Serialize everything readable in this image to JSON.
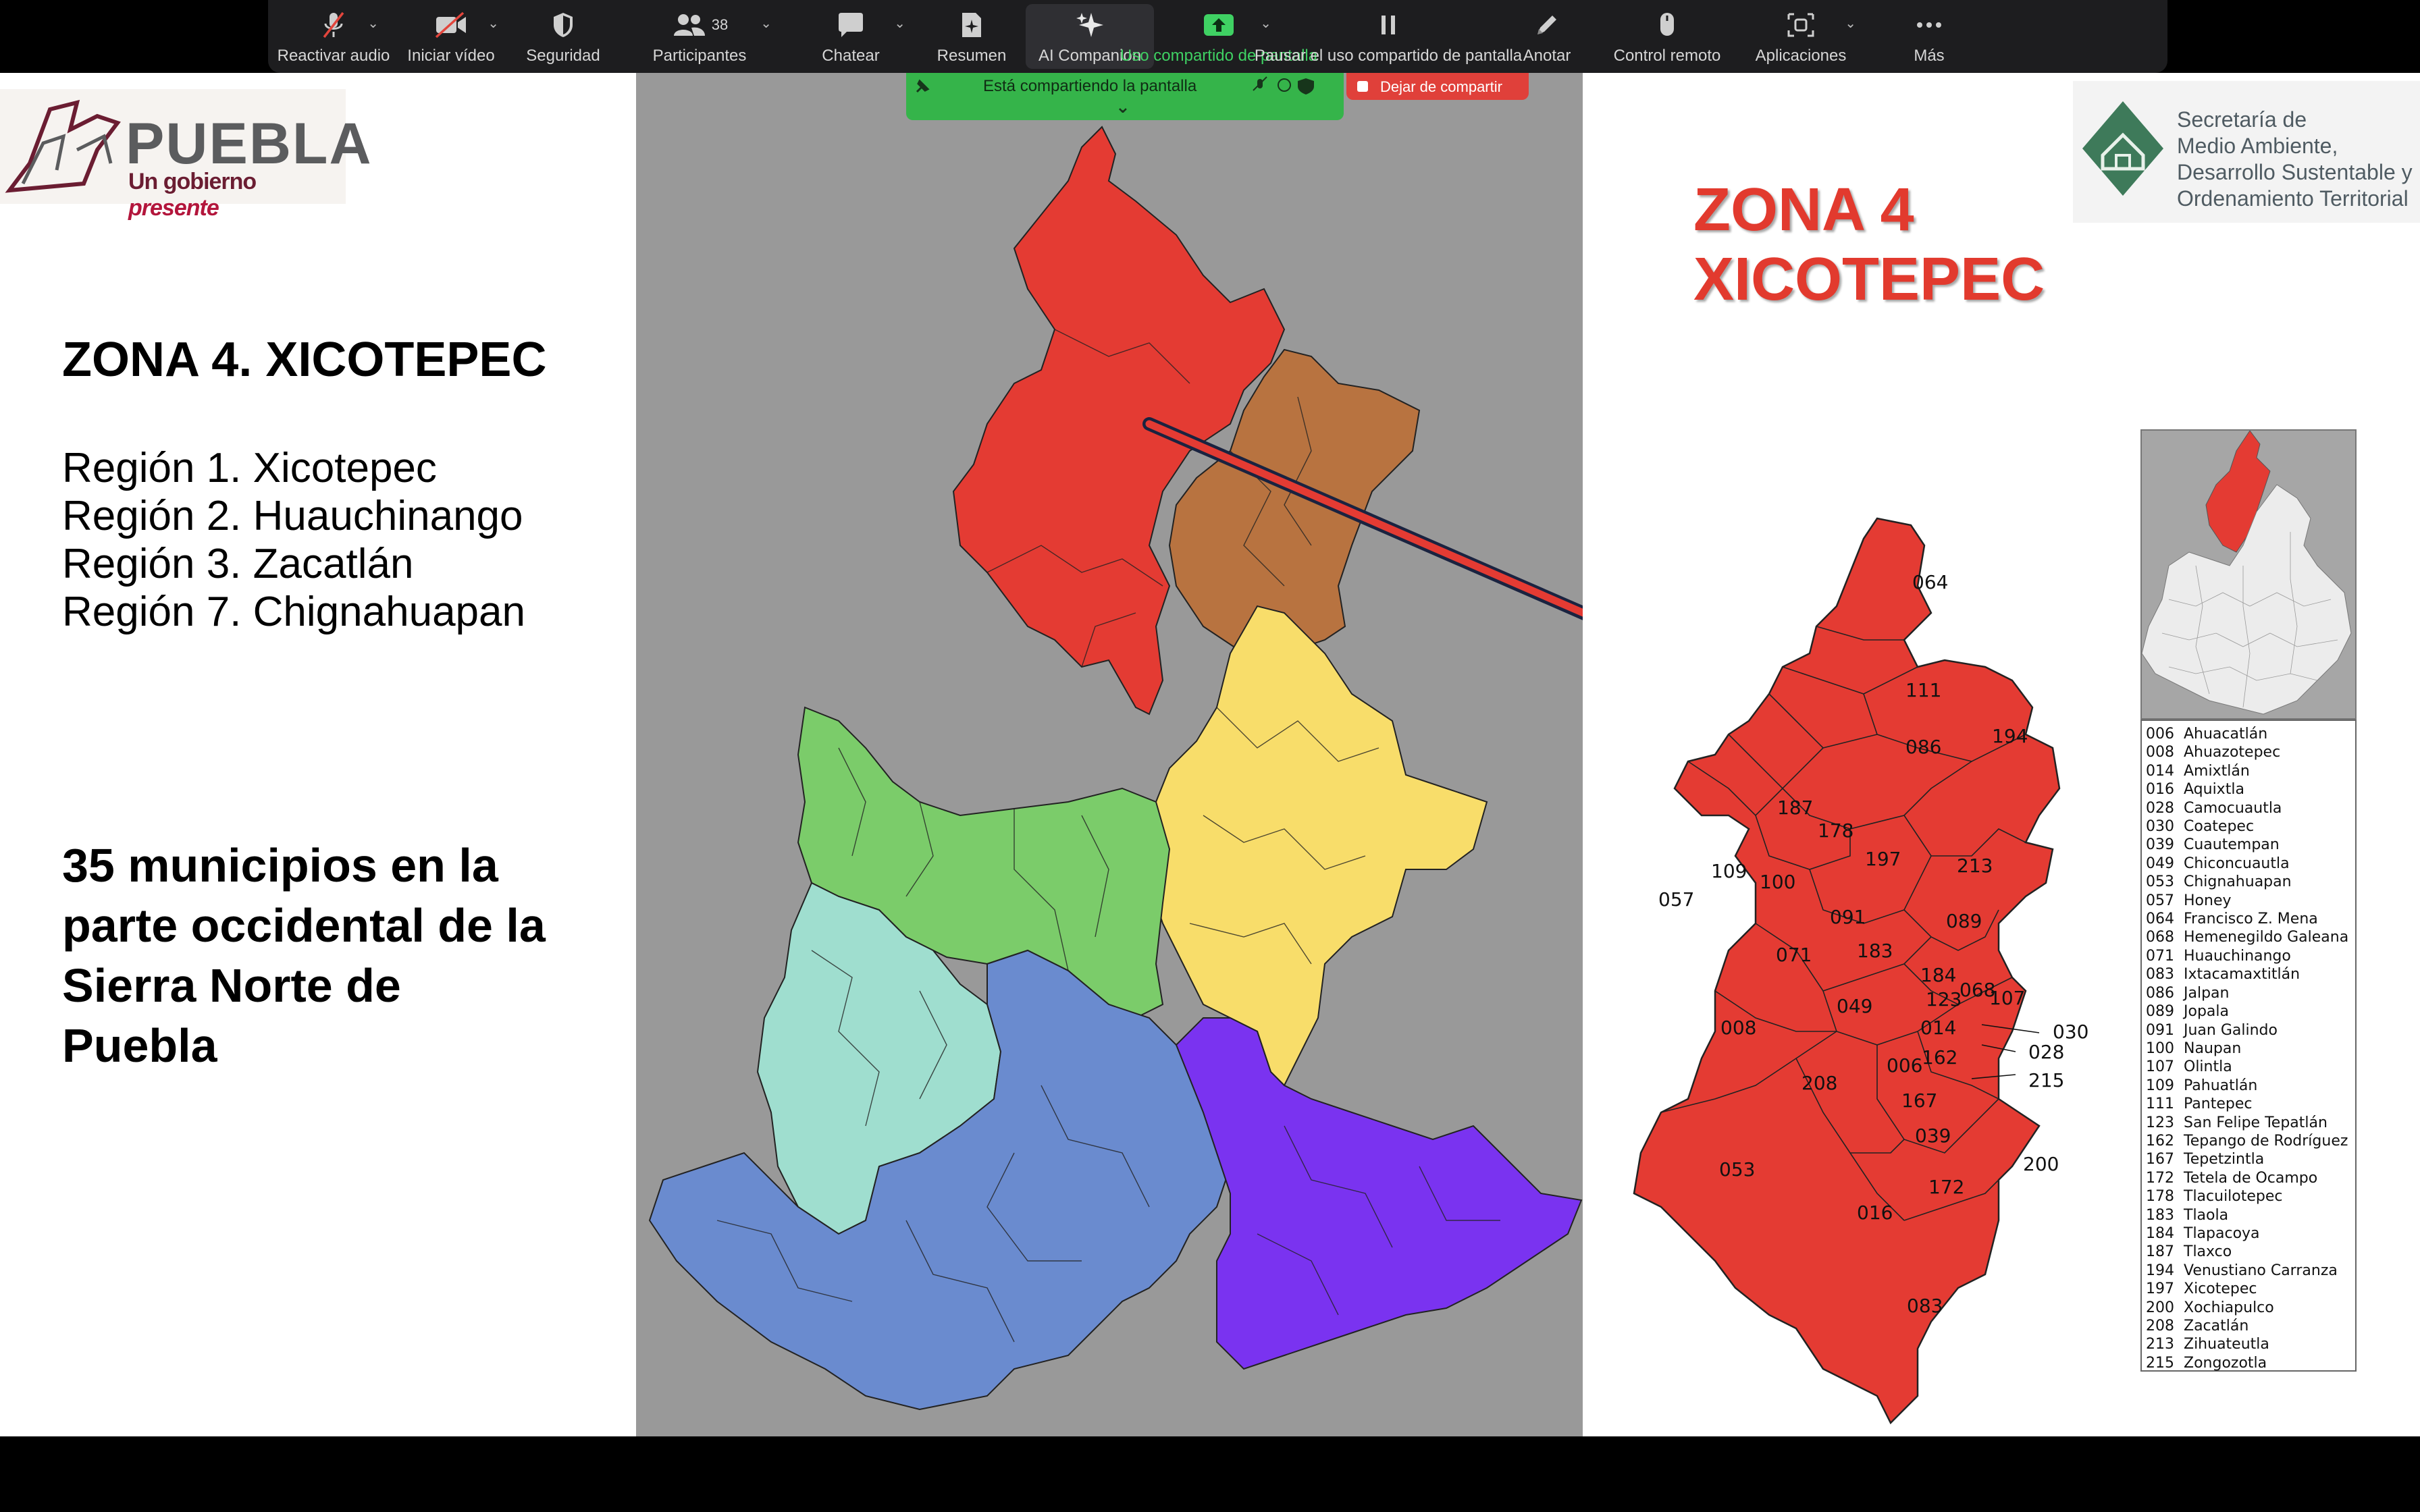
{
  "toolbar": {
    "items": [
      {
        "label": "Reactivar audio",
        "icon": "microphone-muted-icon",
        "caret": true
      },
      {
        "label": "Iniciar vídeo",
        "icon": "video-off-icon",
        "caret": true
      },
      {
        "label": "Seguridad",
        "icon": "shield-icon",
        "caret": false
      },
      {
        "label": "Participantes",
        "icon": "participants-icon",
        "caret": true,
        "count": "38"
      },
      {
        "label": "Chatear",
        "icon": "chat-icon",
        "caret": true
      },
      {
        "label": "Resumen",
        "icon": "summary-icon",
        "caret": false
      },
      {
        "label": "AI Companion",
        "icon": "sparkle-icon",
        "caret": false
      },
      {
        "label": "Uso compartido de pantalla",
        "icon": "share-screen-icon",
        "caret": true
      },
      {
        "label": "Pausar el uso compartido de pantalla",
        "icon": "pause-icon",
        "caret": false
      },
      {
        "label": "Anotar",
        "icon": "pencil-icon",
        "caret": false
      },
      {
        "label": "Control remoto",
        "icon": "mouse-icon",
        "caret": false
      },
      {
        "label": "Aplicaciones",
        "icon": "apps-icon",
        "caret": true
      },
      {
        "label": "Más",
        "icon": "more-icon",
        "caret": false
      }
    ]
  },
  "share_banner": {
    "text": "Está compartiendo la pantalla",
    "stop_label": "Dejar de compartir"
  },
  "logos": {
    "puebla_word": "PUEBLA",
    "puebla_tag_plain": "Un gobierno ",
    "puebla_tag_em": "presente",
    "semadesot_lines": [
      "Secretaría de",
      "Medio Ambiente,",
      "Desarrollo Sustentable y",
      "Ordenamiento Territorial"
    ]
  },
  "slide": {
    "left_title": "ZONA 4. XICOTEPEC",
    "regions": [
      "Región 1. Xicotepec",
      "Región 2. Huauchinango",
      "Región 3. Zacatlán",
      "Región 7. Chignahuapan"
    ],
    "municipios_lines": [
      "35 municipios en la",
      "parte occidental de la",
      "Sierra Norte de",
      "Puebla"
    ],
    "zona_title_lines": [
      "ZONA 4",
      "XICOTEPEC"
    ]
  },
  "zone_map_labels": [
    "064",
    "111",
    "194",
    "086",
    "187",
    "178",
    "109",
    "100",
    "057",
    "197",
    "213",
    "091",
    "089",
    "071",
    "183",
    "184",
    "068",
    "107",
    "123",
    "049",
    "014",
    "008",
    "006",
    "162",
    "030",
    "028",
    "215",
    "208",
    "167",
    "039",
    "053",
    "200",
    "172",
    "016",
    "083"
  ],
  "legend": [
    {
      "code": "006",
      "name": "Ahuacatlán"
    },
    {
      "code": "008",
      "name": "Ahuazotepec"
    },
    {
      "code": "014",
      "name": "Amixtlán"
    },
    {
      "code": "016",
      "name": "Aquixtla"
    },
    {
      "code": "028",
      "name": "Camocuautla"
    },
    {
      "code": "030",
      "name": "Coatepec"
    },
    {
      "code": "039",
      "name": "Cuautempan"
    },
    {
      "code": "049",
      "name": "Chiconcuautla"
    },
    {
      "code": "053",
      "name": "Chignahuapan"
    },
    {
      "code": "057",
      "name": "Honey"
    },
    {
      "code": "064",
      "name": "Francisco Z. Mena"
    },
    {
      "code": "068",
      "name": "Hemenegildo Galeana"
    },
    {
      "code": "071",
      "name": "Huauchinango"
    },
    {
      "code": "083",
      "name": "Ixtacamaxtitlán"
    },
    {
      "code": "086",
      "name": "Jalpan"
    },
    {
      "code": "089",
      "name": "Jopala"
    },
    {
      "code": "091",
      "name": "Juan Galindo"
    },
    {
      "code": "100",
      "name": "Naupan"
    },
    {
      "code": "107",
      "name": "Olintla"
    },
    {
      "code": "109",
      "name": "Pahuatlán"
    },
    {
      "code": "111",
      "name": "Pantepec"
    },
    {
      "code": "123",
      "name": "San Felipe Tepatlán"
    },
    {
      "code": "162",
      "name": "Tepango de Rodríguez"
    },
    {
      "code": "167",
      "name": "Tepetzintla"
    },
    {
      "code": "172",
      "name": "Tetela de Ocampo"
    },
    {
      "code": "178",
      "name": "Tlacuilotepec"
    },
    {
      "code": "183",
      "name": "Tlaola"
    },
    {
      "code": "184",
      "name": "Tlapacoya"
    },
    {
      "code": "187",
      "name": "Tlaxco"
    },
    {
      "code": "194",
      "name": "Venustiano Carranza"
    },
    {
      "code": "197",
      "name": "Xicotepec"
    },
    {
      "code": "200",
      "name": "Xochiapulco"
    },
    {
      "code": "208",
      "name": "Zacatlán"
    },
    {
      "code": "213",
      "name": "Zihuateutla"
    },
    {
      "code": "215",
      "name": "Zongozotla"
    }
  ],
  "colors": {
    "zona4_red": "#e43b33",
    "huauchinango_brown": "#b87340",
    "yellow": "#f8dd6a",
    "green": "#7bcc6a",
    "teal": "#9fdecf",
    "blue": "#6a8bcf",
    "purple": "#7a33f0",
    "panel_gray": "#999999"
  },
  "presenter_controls": [
    "arrow-left-icon",
    "pencil-icon",
    "magnifier-icon",
    "captions-icon",
    "camera-icon",
    "more-icon",
    "arrow-right-icon"
  ]
}
